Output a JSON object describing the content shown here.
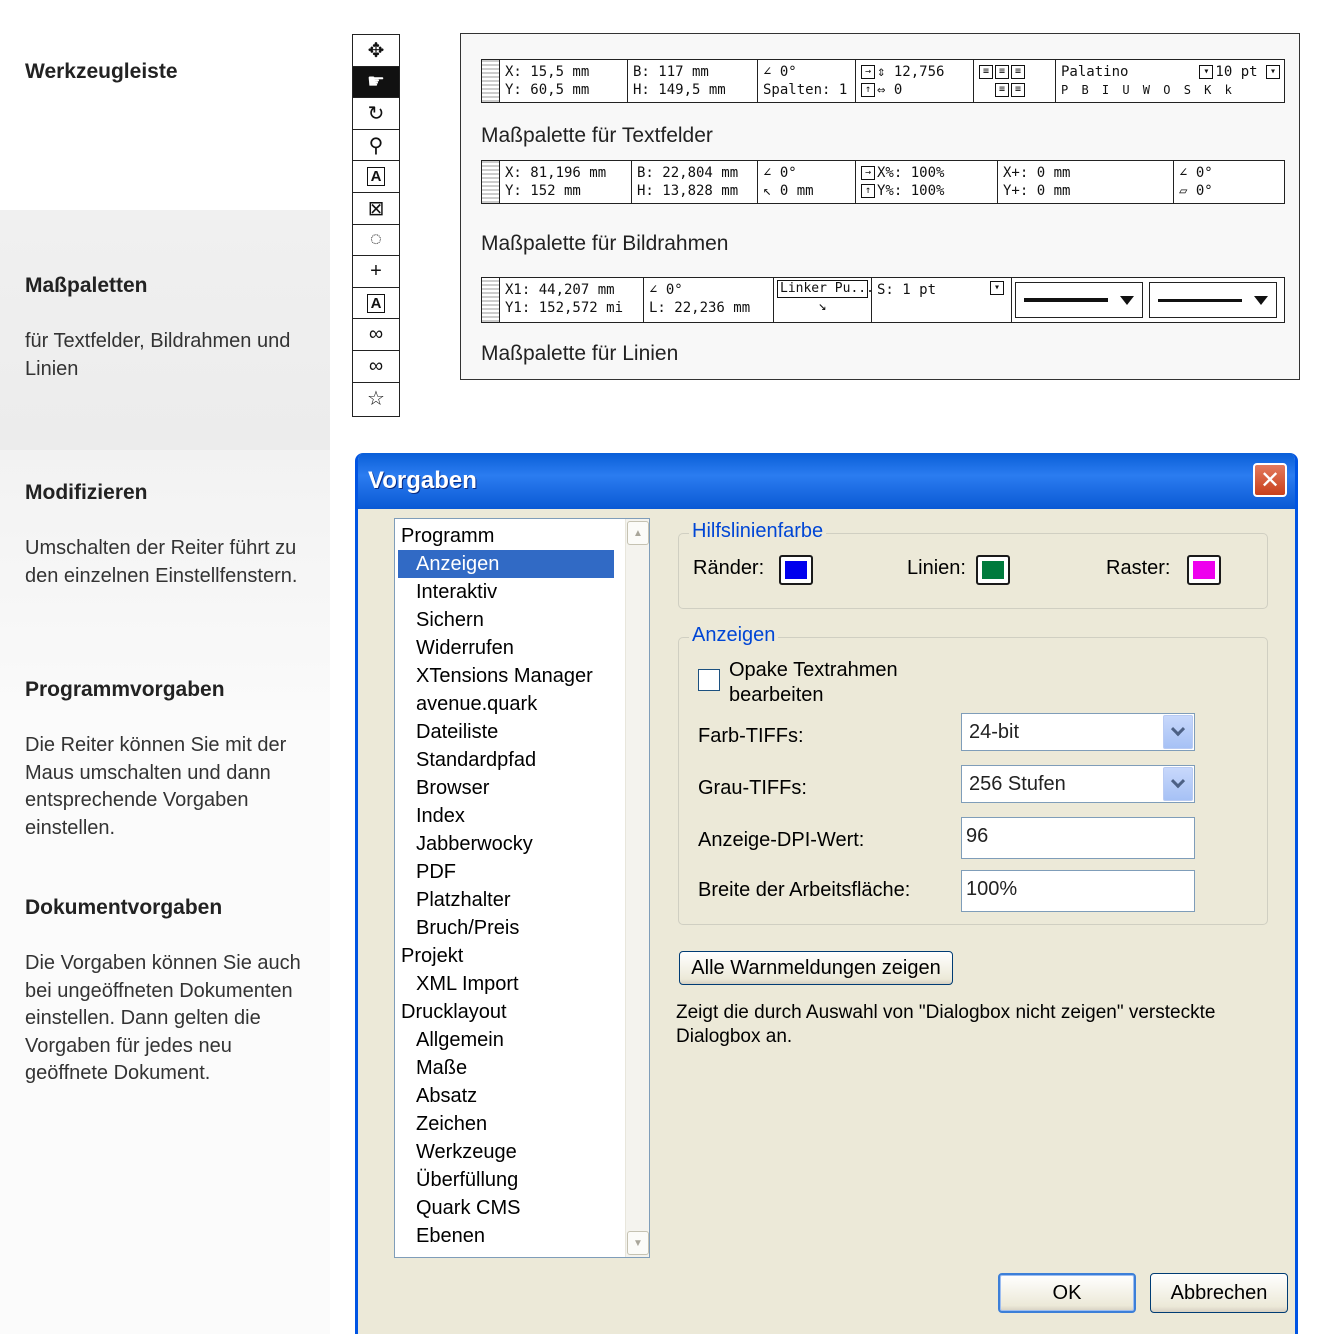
{
  "left": {
    "s1_title": "Werkzeugleiste",
    "s2_title": "Maßpaletten",
    "s2_text": "für Textfelder, Bildrahmen und Linien",
    "s3_title": "Modifizieren",
    "s3_text": "Umschalten der Reiter führt zu den einzelnen Einstell­fenstern.",
    "s4_title": "Programmvorgaben",
    "s4_text": "Die Reiter können Sie mit der Maus umschalten und dann entsprechende Vorga­ben einstellen.",
    "s5_title": "Dokumentvorgaben",
    "s5_text": "Die Vorgaben können Sie auch bei ungeöffneten Do­kumenten einstellen. Dann gelten die Vorgaben für je­des neu geöffnete Doku­ment."
  },
  "toolbar": {
    "tools": [
      {
        "icon": "move-icon",
        "glyph": "✥"
      },
      {
        "icon": "hand-icon",
        "glyph": "☛"
      },
      {
        "icon": "rotate-icon",
        "glyph": "↻"
      },
      {
        "icon": "zoom-icon",
        "glyph": "⚲"
      },
      {
        "icon": "text-box-icon",
        "glyph": "A"
      },
      {
        "icon": "picture-box-icon",
        "glyph": "⊠"
      },
      {
        "icon": "bezier-icon",
        "glyph": "◌"
      },
      {
        "icon": "line-icon",
        "glyph": "+"
      },
      {
        "icon": "text-path-icon",
        "glyph": "A"
      },
      {
        "icon": "link-icon",
        "glyph": "∞"
      },
      {
        "icon": "unlink-icon",
        "glyph": "∞"
      },
      {
        "icon": "star-icon",
        "glyph": "☆"
      }
    ]
  },
  "palettes": {
    "text": {
      "xy": [
        "X: 15,5  mm",
        "Y: 60,5  mm"
      ],
      "wh": [
        "B: 117  mm",
        "H: 149,5  mm"
      ],
      "angle": [
        "∠ 0°",
        "Spalten: 1"
      ],
      "lead": [
        "⇕ 12,756",
        "⇔ 0"
      ],
      "font": "Palatino",
      "size": "10 pt",
      "styles": "P B I U W O S K k"
    },
    "text_caption": "Maßpalette für Textfelder",
    "picture": {
      "xy": [
        "X: 81,196  mm",
        "Y: 152  mm"
      ],
      "wh": [
        "B: 22,804  mm",
        "H: 13,828  mm"
      ],
      "angle": [
        "∠ 0°",
        "↖ 0  mm"
      ],
      "scale": [
        "X%: 100%",
        "Y%: 100%"
      ],
      "offset": [
        "X+: 0  mm",
        "Y+: 0  mm"
      ],
      "rot": [
        "∠ 0°",
        "▱ 0°"
      ]
    },
    "picture_caption": "Maßpalette für Bildrahmen",
    "line": {
      "xy": [
        "X1: 44,207  mm",
        "Y1: 152,572  mi"
      ],
      "angle": [
        "∠  0°",
        "L:  22,236  mm"
      ],
      "mode": "Linker Pu...",
      "width": "S: 1  pt"
    },
    "line_caption": "Maßpalette für Linien"
  },
  "dialog": {
    "title": "Vorgaben",
    "close": "✕",
    "list": [
      {
        "label": "Programm",
        "level": 0
      },
      {
        "label": "Anzeigen",
        "level": 1,
        "selected": true
      },
      {
        "label": "Interaktiv",
        "level": 1
      },
      {
        "label": "Sichern",
        "level": 1
      },
      {
        "label": "Widerrufen",
        "level": 1
      },
      {
        "label": "XTensions Manager",
        "level": 1
      },
      {
        "label": "avenue.quark",
        "level": 1
      },
      {
        "label": "Dateiliste",
        "level": 1
      },
      {
        "label": "Standardpfad",
        "level": 1
      },
      {
        "label": "Browser",
        "level": 1
      },
      {
        "label": "Index",
        "level": 1
      },
      {
        "label": "Jabberwocky",
        "level": 1
      },
      {
        "label": "PDF",
        "level": 1
      },
      {
        "label": "Platzhalter",
        "level": 1
      },
      {
        "label": "Bruch/Preis",
        "level": 1
      },
      {
        "label": "Projekt",
        "level": 0
      },
      {
        "label": "XML Import",
        "level": 1
      },
      {
        "label": "Drucklayout",
        "level": 0
      },
      {
        "label": "Allgemein",
        "level": 1
      },
      {
        "label": "Maße",
        "level": 1
      },
      {
        "label": "Absatz",
        "level": 1
      },
      {
        "label": "Zeichen",
        "level": 1
      },
      {
        "label": "Werkzeuge",
        "level": 1
      },
      {
        "label": "Überfüllung",
        "level": 1
      },
      {
        "label": "Quark CMS",
        "level": 1
      },
      {
        "label": "Ebenen",
        "level": 1
      }
    ],
    "guide_group": "Hilfslinienfarbe",
    "margins_label": "Ränder:",
    "margins_color": "#0000ee",
    "ruler_label": "Linien:",
    "ruler_color": "#007a3d",
    "grid_label": "Raster:",
    "grid_color": "#ee00ee",
    "display_group": "Anzeigen",
    "opaque_line1": "Opake Textrahmen",
    "opaque_line2": "bearbeiten",
    "color_tiffs_label": "Farb-TIFFs:",
    "color_tiffs_value": "24-bit",
    "gray_tiffs_label": "Grau-TIFFs:",
    "gray_tiffs_value": "256 Stufen",
    "dpi_label": "Anzeige-DPI-Wert:",
    "dpi_value": "96",
    "pasteboard_label": "Breite der Arbeitsfläche:",
    "pasteboard_value": "100%",
    "alerts_button": "Alle Warnmeldungen zeigen",
    "alerts_desc": "Zeigt die durch Auswahl von \"Dialogbox nicht zeigen\" versteckte Dialogbox an.",
    "ok": "OK",
    "cancel": "Abbrechen"
  }
}
